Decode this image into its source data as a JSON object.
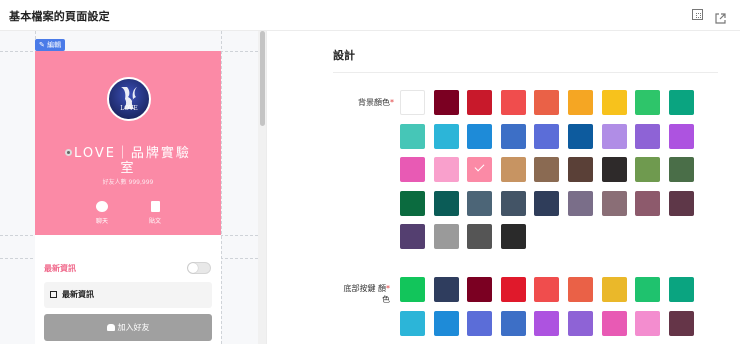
{
  "header": {
    "title": "基本檔案的頁面設定"
  },
  "preview": {
    "edit_badge": "編輯",
    "logo_text": "LOVE",
    "brand_name_line1": "LOVE｜品牌實驗",
    "brand_name_line2": "室",
    "friends_label": "好友人數 999,999",
    "actions": [
      {
        "label": "聊天",
        "icon": "chat-bubble-icon"
      },
      {
        "label": "貼文",
        "icon": "post-document-icon"
      }
    ],
    "news_section_title": "最新資訊",
    "news_toggle_on": false,
    "news_item": "最新資訊",
    "add_friend_button": "加入好友",
    "colors": {
      "card_background": "#fb8aa6",
      "accent": "#f06a8c",
      "button": "#a0a0a0"
    }
  },
  "settings": {
    "section_title": "設計",
    "background_color": {
      "label": "背景顏色",
      "required_mark": "*",
      "selected": "#fb8aa6",
      "swatches": [
        "#ffffff",
        "#7b0022",
        "#c8192b",
        "#f04d4d",
        "#ea6147",
        "#f5a623",
        "#f7c21c",
        "#2ec56a",
        "#0aa480",
        "#46c6b7",
        "#2cb5d8",
        "#1e8bd8",
        "#3d6fc6",
        "#5b6dd8",
        "#0d5b9e",
        "#b08de6",
        "#8e63d6",
        "#ad53e0",
        "#e85ab4",
        "#f9a0cc",
        "#fb8aa6",
        "#c79462",
        "#8a6a52",
        "#5a4037",
        "#2e2a2a",
        "#6f9a4f",
        "#4a6e48",
        "#0b6b3f",
        "#0b5c57",
        "#4c6577",
        "#435466",
        "#2f3d5a",
        "#7a6e89",
        "#8a6e76",
        "#8d5a6c",
        "#5e3748",
        "#543f70",
        "#9a9a9a",
        "#555555",
        "#2a2a2a"
      ]
    },
    "footer_button_color": {
      "label_line1": "底部按鍵 顏",
      "label_line2": "色",
      "required_mark": "*",
      "swatches": [
        "#12c55b",
        "#2f3d5e",
        "#7b0022",
        "#e0192b",
        "#f04d4d",
        "#ea6147",
        "#eab82a",
        "#1fc26e",
        "#0aa480",
        "#2cb5d8",
        "#1e8bd8",
        "#5b6dd8",
        "#3d6fc6",
        "#ad53e0",
        "#8e63d6",
        "#e85ab4",
        "#f38dcf",
        "#653548"
      ]
    }
  }
}
